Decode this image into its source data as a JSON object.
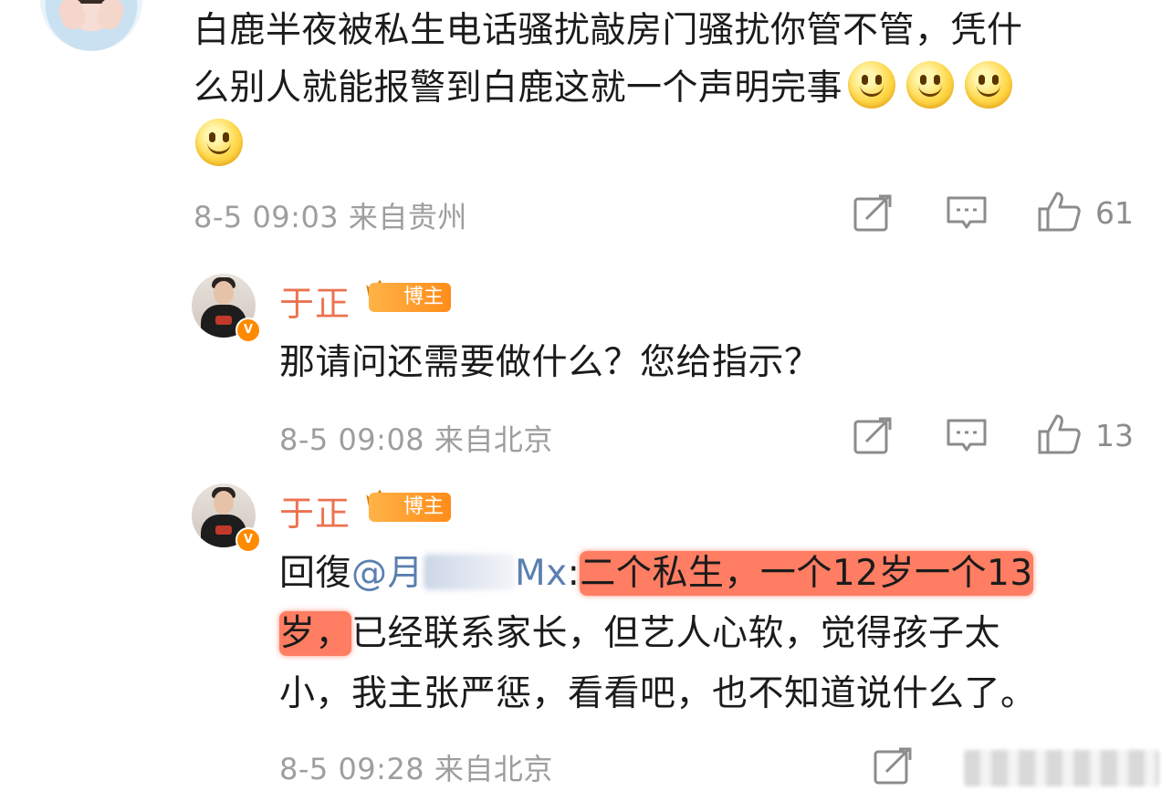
{
  "comment_top": {
    "text_line1": "白鹿半夜被私生电话骚扰敲房门骚扰你管不管，凭什",
    "text_line2": "么别人就能报警到白鹿这就一个声明完事",
    "emoji_names": [
      "smile-emoji",
      "smile-emoji",
      "smile-emoji",
      "smile-emoji"
    ],
    "timestamp": "8-5 09:03",
    "location": "来自贵州",
    "like_count": "61"
  },
  "reply1": {
    "author": "于正",
    "badge": "博主",
    "text": "那请问还需要做什么？您给指示？",
    "timestamp": "8-5 09:08",
    "location": "来自北京",
    "like_count": "13"
  },
  "reply2": {
    "author": "于正",
    "badge": "博主",
    "prefix": "回復",
    "mention_start": "@月",
    "mention_end": "Mx",
    "colon": ":",
    "highlight1": "二个私生，一个12岁一个13",
    "highlight2": "岁，",
    "rest_line2": "已经联系家长，但艺人心软，觉得孩子太",
    "line3": "小，我主张严惩，看看吧，也不知道说什么了。",
    "timestamp": "8-5 09:28",
    "location": "来自北京"
  },
  "colors": {
    "name": "#eb7350",
    "meta": "#9e9e9e",
    "highlight": "#ff6646",
    "vbadge": "#ff8a00"
  },
  "icons": [
    "share-icon",
    "comment-icon",
    "like-icon",
    "crown-icon",
    "verified-icon"
  ]
}
